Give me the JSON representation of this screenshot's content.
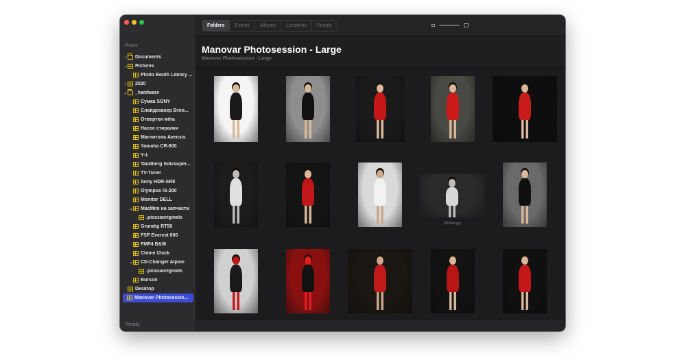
{
  "window": {
    "status": "Ready."
  },
  "sidebar": {
    "header": "Photos",
    "items": [
      {
        "label": "Documents",
        "indent": 0,
        "chevron": "›",
        "icon": "folder-icon"
      },
      {
        "label": "Pictures",
        "indent": 0,
        "chevron": "⌄",
        "icon": "album-icon"
      },
      {
        "label": "Photo Booth Library ...",
        "indent": 1,
        "chevron": "",
        "icon": "album-icon"
      },
      {
        "label": "2020",
        "indent": 0,
        "chevron": "›",
        "icon": "album-icon"
      },
      {
        "label": "_hardware",
        "indent": 0,
        "chevron": "⌄",
        "icon": "folder-icon"
      },
      {
        "label": "Сумка SONY",
        "indent": 1,
        "chevron": "",
        "icon": "album-icon"
      },
      {
        "label": "Слайдсканер Broo...",
        "indent": 1,
        "chevron": "",
        "icon": "album-icon"
      },
      {
        "label": "Отвертки wiha",
        "indent": 1,
        "chevron": "",
        "icon": "album-icon"
      },
      {
        "label": "Насос стиралки",
        "indent": 1,
        "chevron": "",
        "icon": "album-icon"
      },
      {
        "label": "Магнитола Avensis",
        "indent": 1,
        "chevron": "",
        "icon": "album-icon"
      },
      {
        "label": "Yamaha CR-600",
        "indent": 1,
        "chevron": "",
        "icon": "album-icon"
      },
      {
        "label": "Y-1",
        "indent": 1,
        "chevron": "",
        "icon": "album-icon"
      },
      {
        "label": "Tandberg Solvsuper...",
        "indent": 1,
        "chevron": "",
        "icon": "album-icon"
      },
      {
        "label": "TV-Tuner",
        "indent": 1,
        "chevron": "",
        "icon": "album-icon"
      },
      {
        "label": "Sony HDR-SR8",
        "indent": 1,
        "chevron": "",
        "icon": "album-icon"
      },
      {
        "label": "Olympus IS-200",
        "indent": 1,
        "chevron": "",
        "icon": "album-icon"
      },
      {
        "label": "Monitor DELL",
        "indent": 1,
        "chevron": "",
        "icon": "album-icon"
      },
      {
        "label": "MacMini на запчасти",
        "indent": 1,
        "chevron": "⌄",
        "icon": "album-icon"
      },
      {
        "label": ".picasaoriginals",
        "indent": 2,
        "chevron": "",
        "icon": "album-icon"
      },
      {
        "label": "Grundig RT50",
        "indent": 1,
        "chevron": "",
        "icon": "album-icon"
      },
      {
        "label": "FSP Everest 800",
        "indent": 1,
        "chevron": "",
        "icon": "album-icon"
      },
      {
        "label": "FMP4 B&W",
        "indent": 1,
        "chevron": "",
        "icon": "album-icon"
      },
      {
        "label": "Chime Clock",
        "indent": 1,
        "chevron": "",
        "icon": "album-icon"
      },
      {
        "label": "CD-Changer Alpine",
        "indent": 1,
        "chevron": "⌄",
        "icon": "album-icon"
      },
      {
        "label": ".picasaoriginals",
        "indent": 2,
        "chevron": "",
        "icon": "album-icon"
      },
      {
        "label": "Burson",
        "indent": 1,
        "chevron": "",
        "icon": "album-icon"
      },
      {
        "label": "Desktop",
        "indent": 0,
        "chevron": "",
        "icon": "album-icon"
      },
      {
        "label": "Manovar Photosessio...",
        "indent": 0,
        "chevron": "",
        "icon": "album-icon",
        "selected": true
      }
    ]
  },
  "toolbar": {
    "tabs": [
      {
        "label": "Folders",
        "active": true
      },
      {
        "label": "Events",
        "active": false
      },
      {
        "label": "Albums",
        "active": false
      },
      {
        "label": "Locations",
        "active": false
      },
      {
        "label": "People",
        "active": false
      }
    ]
  },
  "content": {
    "title": "Manovar Photosession - Large",
    "subtitle": "Manovar Photosession - Large",
    "caption": "3850bw.jpg"
  },
  "photos": [
    {
      "bg": "#f5f5f5",
      "dress": "#1a1a1a",
      "accent": "#d9b89a"
    },
    {
      "bg": "#8e8e8e",
      "dress": "#111111",
      "accent": "#d9b89a"
    },
    {
      "bg": "#1a1a1a",
      "dress": "#c41818",
      "accent": "#d9b89a"
    },
    {
      "bg": "#4a4a44",
      "dress": "#cc1a1a",
      "accent": "#d9b89a"
    },
    {
      "bg": "#0e0e0e",
      "dress": "#c81c1c",
      "accent": "#d9b89a"
    },
    {
      "bg": "#1c1c1c",
      "dress": "#e0e0e0",
      "accent": "#bdbdbd"
    },
    {
      "bg": "#141414",
      "dress": "#c01818",
      "accent": "#d9b89a"
    },
    {
      "bg": "#dadada",
      "dress": "#f2f2f2",
      "accent": "#c9a98a"
    },
    {
      "bg": "#2a2a2a",
      "dress": "#d8d8d8",
      "accent": "#bdbdbd"
    },
    {
      "bg": "#6a6a6a",
      "dress": "#101010",
      "accent": "#d9b89a"
    },
    {
      "bg": "#d0d0d0",
      "dress": "#1a1a1a",
      "accent": "#c41818"
    },
    {
      "bg": "#8a1010",
      "dress": "#111111",
      "accent": "#e02020"
    },
    {
      "bg": "#1a1612",
      "dress": "#c21a1a",
      "accent": "#c9a98a"
    },
    {
      "bg": "#121212",
      "dress": "#b81616",
      "accent": "#d9b89a"
    },
    {
      "bg": "#101010",
      "dress": "#c41818",
      "accent": "#d9b89a"
    }
  ]
}
